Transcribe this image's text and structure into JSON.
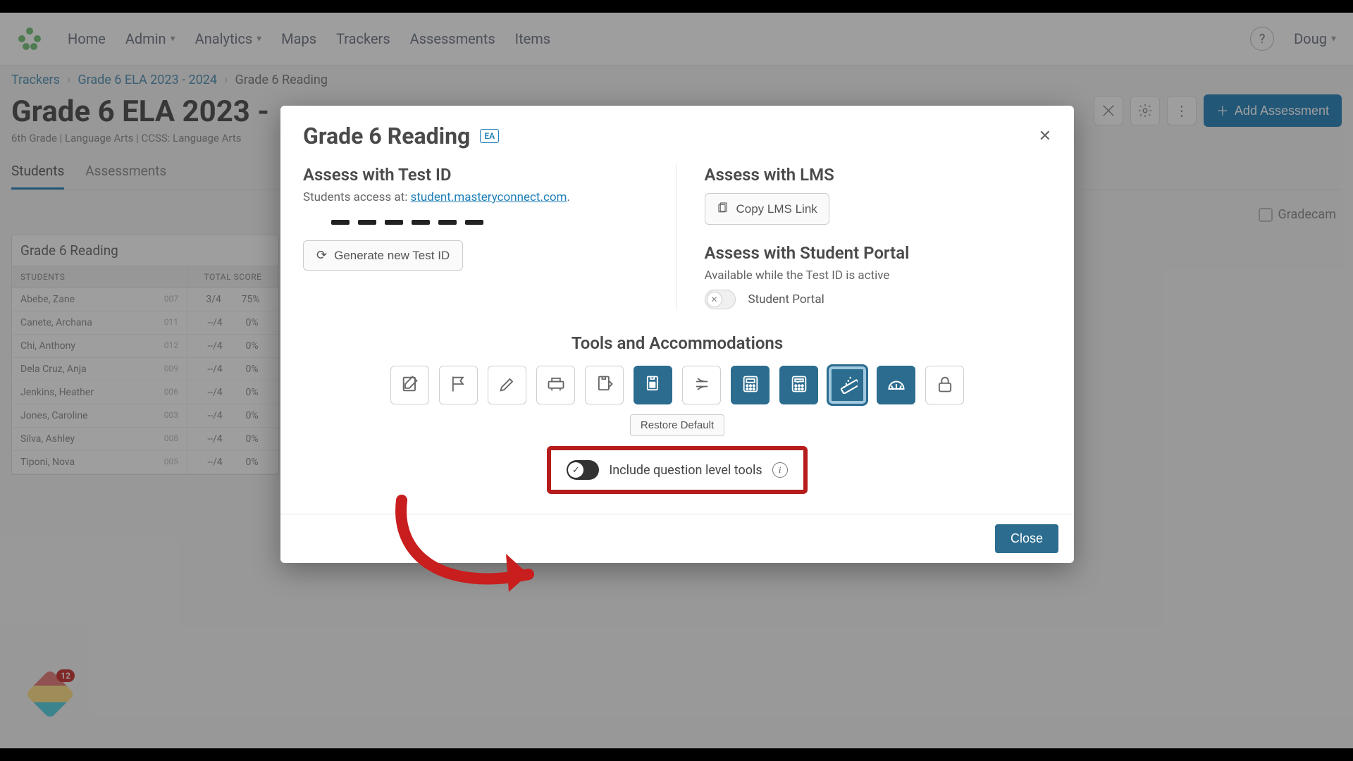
{
  "nav": {
    "home": "Home",
    "admin": "Admin",
    "analytics": "Analytics",
    "maps": "Maps",
    "trackers": "Trackers",
    "assessments": "Assessments",
    "items": "Items",
    "user": "Doug"
  },
  "breadcrumbs": {
    "a": "Trackers",
    "b": "Grade 6 ELA 2023 - 2024",
    "c": "Grade 6 Reading"
  },
  "page": {
    "title": "Grade 6 ELA 2023 - ",
    "subtitle": "6th Grade  |  Language Arts  |  CCSS: Language Arts",
    "add_btn": "Add Assessment",
    "tab_students": "Students",
    "tab_assessments": "Assessments",
    "gradecam": "Gradecam"
  },
  "table": {
    "title": "Grade 6 Reading",
    "col1": "Students",
    "col2": "TOTAL SCORE",
    "rows": [
      {
        "name": "Abebe, Zane",
        "id": "007",
        "s": "3/4",
        "p": "75%"
      },
      {
        "name": "Canete, Archana",
        "id": "011",
        "s": "--/4",
        "p": "0%"
      },
      {
        "name": "Chi, Anthony",
        "id": "012",
        "s": "--/4",
        "p": "0%"
      },
      {
        "name": "Dela Cruz, Anja",
        "id": "009",
        "s": "--/4",
        "p": "0%"
      },
      {
        "name": "Jenkins, Heather",
        "id": "006",
        "s": "--/4",
        "p": "0%"
      },
      {
        "name": "Jones, Caroline",
        "id": "003",
        "s": "--/4",
        "p": "0%"
      },
      {
        "name": "Silva, Ashley",
        "id": "008",
        "s": "--/4",
        "p": "0%"
      },
      {
        "name": "Tiponi, Nova",
        "id": "005",
        "s": "--/4",
        "p": "0%"
      }
    ]
  },
  "badge": {
    "count": "12"
  },
  "modal": {
    "title": "Grade 6 Reading",
    "ea": "EA",
    "assess_testid_title": "Assess with Test ID",
    "assess_testid_text_pre": "Students access at: ",
    "assess_testid_link": "student.masteryconnect.com",
    "gen_btn": "Generate new Test ID",
    "assess_lms_title": "Assess with LMS",
    "copy_lms": "Copy LMS Link",
    "assess_portal_title": "Assess with Student Portal",
    "portal_avail": "Available while the Test ID is active",
    "portal_label": "Student Portal",
    "tools_title": "Tools and Accommodations",
    "restore": "Restore Default",
    "qlt_label": "Include question level tools",
    "close": "Close",
    "tool_names": [
      "notepad",
      "flag",
      "highlighter",
      "line-reader",
      "scratchpad",
      "color-contrast",
      "strikethrough",
      "basic-calculator",
      "scientific-calculator",
      "ruler",
      "protractor",
      "lock"
    ]
  }
}
